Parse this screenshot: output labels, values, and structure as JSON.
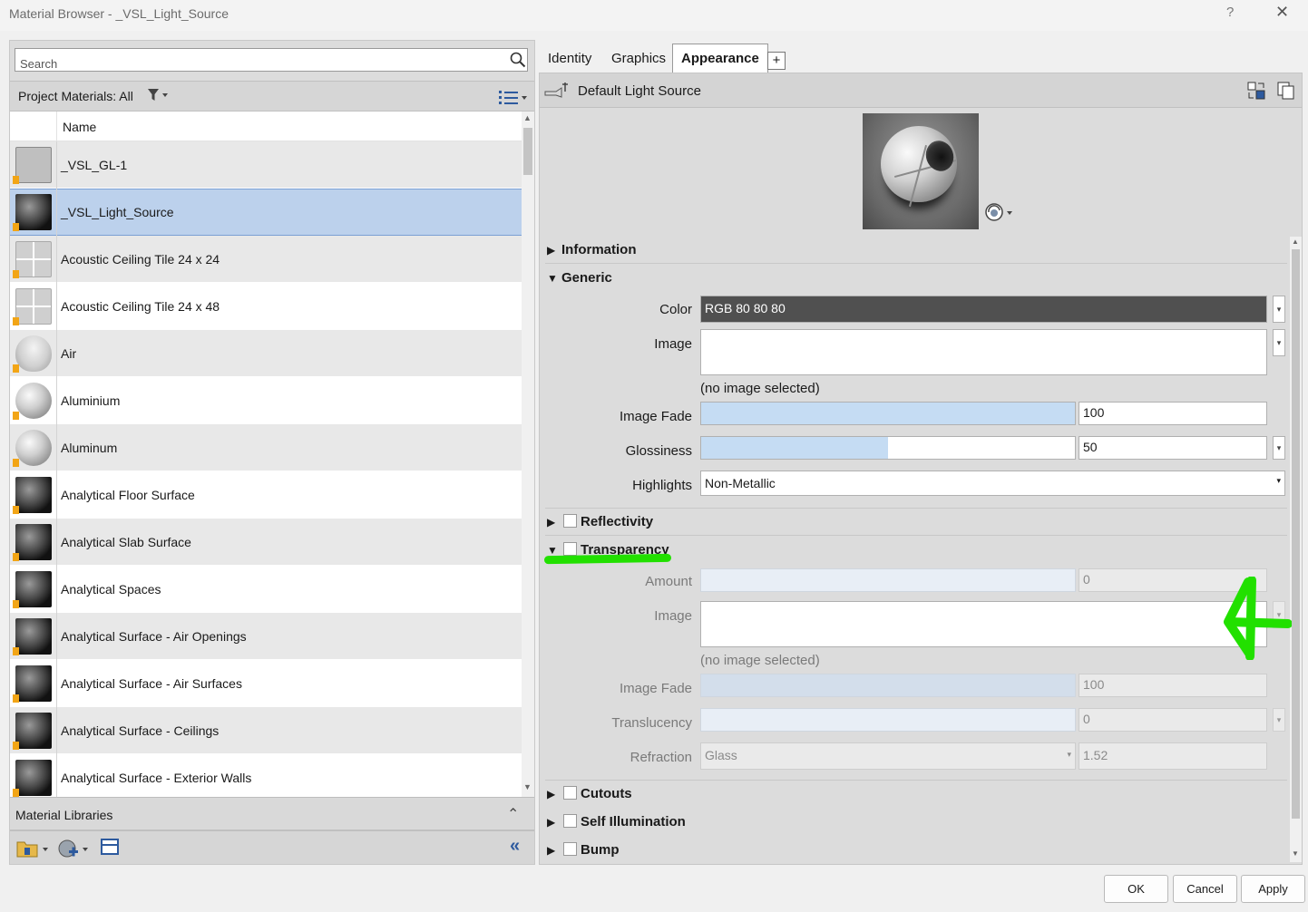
{
  "window": {
    "title": "Material Browser - _VSL_Light_Source",
    "help_label": "?",
    "close_label": "✕"
  },
  "left_panel": {
    "search_placeholder": "Search",
    "filter_label": "Project Materials: All",
    "column_name": "Name",
    "materials": [
      {
        "name": "_VSL_GL-1",
        "thumb": "glass"
      },
      {
        "name": "_VSL_Light_Source",
        "thumb": "sphere-dark",
        "selected": true
      },
      {
        "name": "Acoustic Ceiling Tile 24 x 24",
        "thumb": "tile"
      },
      {
        "name": "Acoustic Ceiling Tile 24 x 48",
        "thumb": "tile"
      },
      {
        "name": "Air",
        "thumb": "air"
      },
      {
        "name": "Aluminium",
        "thumb": "sphere-light"
      },
      {
        "name": "Aluminum",
        "thumb": "sphere-light"
      },
      {
        "name": "Analytical Floor Surface",
        "thumb": "sphere-dark"
      },
      {
        "name": "Analytical Slab Surface",
        "thumb": "sphere-dark"
      },
      {
        "name": "Analytical Spaces",
        "thumb": "sphere-dark"
      },
      {
        "name": "Analytical Surface - Air Openings",
        "thumb": "sphere-dark"
      },
      {
        "name": "Analytical Surface - Air Surfaces",
        "thumb": "sphere-dark"
      },
      {
        "name": "Analytical Surface - Ceilings",
        "thumb": "sphere-dark"
      },
      {
        "name": "Analytical Surface - Exterior Walls",
        "thumb": "sphere-dark"
      }
    ],
    "material_libraries_label": "Material Libraries"
  },
  "tabs": [
    {
      "label": "Identity"
    },
    {
      "label": "Graphics"
    },
    {
      "label": "Appearance",
      "active": true
    }
  ],
  "tab_add_label": "+",
  "asset": {
    "name": "Default Light Source"
  },
  "sections": {
    "information": "Information",
    "generic": "Generic",
    "reflectivity": "Reflectivity",
    "transparency": "Transparency",
    "cutouts": "Cutouts",
    "self_illumination": "Self Illumination",
    "bump": "Bump"
  },
  "generic": {
    "color_label": "Color",
    "color_value": "RGB 80 80 80",
    "color_hex": "#505050",
    "image_label": "Image",
    "image_note": "(no image selected)",
    "image_fade_label": "Image Fade",
    "image_fade_value": "100",
    "image_fade_fraction": 1.0,
    "glossiness_label": "Glossiness",
    "glossiness_value": "50",
    "glossiness_fraction": 0.5,
    "highlights_label": "Highlights",
    "highlights_value": "Non-Metallic"
  },
  "transparency": {
    "amount_label": "Amount",
    "amount_value": "0",
    "image_label": "Image",
    "image_note": "(no image selected)",
    "image_fade_label": "Image Fade",
    "image_fade_value": "100",
    "translucency_label": "Translucency",
    "translucency_value": "0",
    "refraction_label": "Refraction",
    "refraction_value": "Glass",
    "refraction_index": "1.52"
  },
  "footer": {
    "ok": "OK",
    "cancel": "Cancel",
    "apply": "Apply"
  },
  "colors": {
    "selection": "#bcd1ec",
    "slider_fill": "#c5dcf3",
    "annotation": "#22e000",
    "warning": "#f2a516"
  }
}
